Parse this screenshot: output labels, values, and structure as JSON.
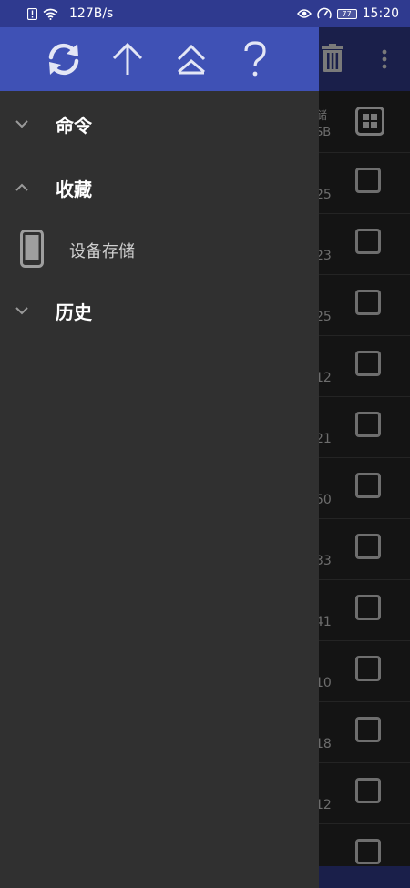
{
  "status_bar": {
    "speed": "127B/s",
    "battery": "77",
    "time": "15:20"
  },
  "background_app": {
    "header_label_line1": "储",
    "header_label_line2": "SB",
    "row_numbers": [
      "25",
      "23",
      "25",
      "12",
      "21",
      "50",
      "33",
      "41",
      "10",
      "18",
      "12",
      ""
    ]
  },
  "drawer": {
    "toolbar": {
      "refresh_icon": "refresh-icon",
      "up_icon": "arrow-up-icon",
      "top_icon": "double-chevron-up-icon",
      "help_icon": "question-mark-icon"
    },
    "sections": [
      {
        "title": "命令",
        "expanded": false
      },
      {
        "title": "收藏",
        "expanded": true
      },
      {
        "title": "历史",
        "expanded": false
      }
    ],
    "favorites": [
      {
        "label": "设备存储",
        "icon": "smartphone-icon"
      }
    ]
  },
  "colors": {
    "status_bar": "#2f3a8f",
    "drawer_toolbar": "#3f51b5",
    "drawer_bg": "#303030",
    "background": "#141414"
  }
}
